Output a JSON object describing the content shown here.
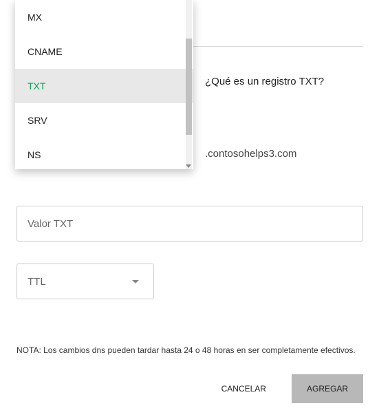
{
  "dropdown": {
    "options": [
      {
        "label": "MX",
        "selected": false
      },
      {
        "label": "CNAME",
        "selected": false
      },
      {
        "label": "TXT",
        "selected": true
      },
      {
        "label": "SRV",
        "selected": false
      },
      {
        "label": "NS",
        "selected": false
      }
    ]
  },
  "helpLink": "¿Qué es un registro TXT?",
  "domainSuffix": ".contosohelps3.com",
  "txtValue": {
    "placeholder": "Valor TXT",
    "value": ""
  },
  "ttl": {
    "label": "TTL"
  },
  "note": "NOTA: Los cambios dns pueden tardar hasta 24 o 48 horas en ser completamente efectivos.",
  "buttons": {
    "cancel": "CANCELAR",
    "add": "AGREGAR"
  }
}
